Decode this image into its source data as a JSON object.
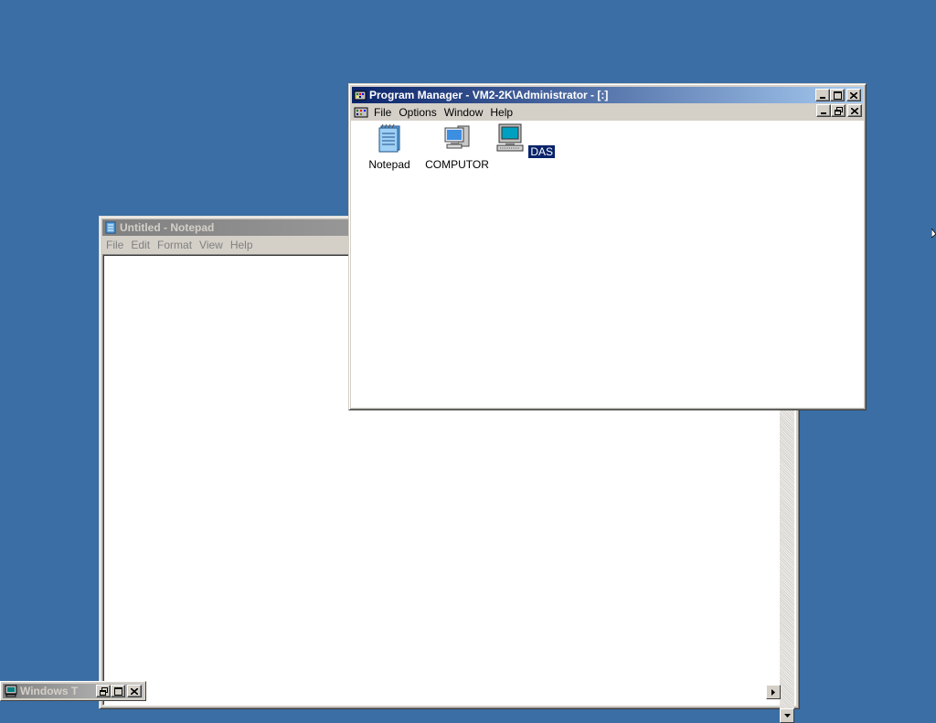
{
  "notepad": {
    "title": "Untitled - Notepad",
    "menu": [
      "File",
      "Edit",
      "Format",
      "View",
      "Help"
    ],
    "text": ""
  },
  "progman": {
    "title": "Program Manager - VM2-2K\\Administrator - [:]",
    "menu": [
      "File",
      "Options",
      "Window",
      "Help"
    ],
    "icons": [
      {
        "label": "Notepad",
        "icon": "notepad-icon",
        "selected": false
      },
      {
        "label": "COMPUTOR",
        "icon": "computer-icon",
        "selected": false
      },
      {
        "label": "DAS",
        "icon": "monitor-icon",
        "selected": true
      }
    ]
  },
  "minimized": {
    "title": "Windows T"
  },
  "colors": {
    "desktop": "#3a6ea5",
    "active_title": "#0a246a",
    "selection": "#0a246a"
  }
}
